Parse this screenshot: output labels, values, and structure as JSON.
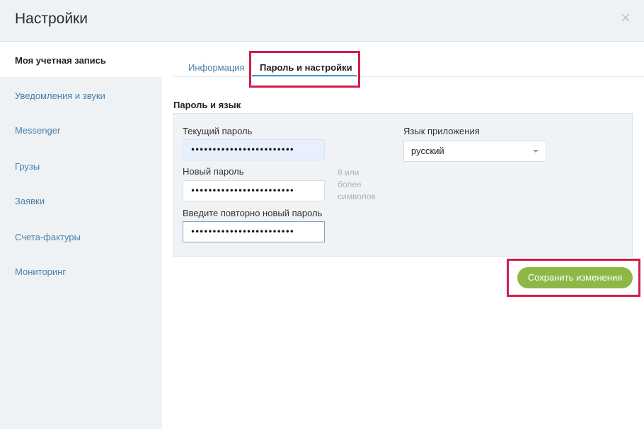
{
  "header": {
    "title": "Настройки",
    "close_glyph": "×"
  },
  "sidebar": {
    "items": [
      {
        "label": "Моя учетная запись",
        "active": true
      },
      {
        "label": "Уведомления и звуки"
      },
      {
        "label": "Messenger"
      },
      {
        "label": "Грузы"
      },
      {
        "label": "Заявки"
      },
      {
        "label": "Счета-фактуры"
      },
      {
        "label": "Мониторинг"
      }
    ]
  },
  "tabs": [
    {
      "label": "Информация",
      "active": false
    },
    {
      "label": "Пароль и настройки",
      "active": true
    }
  ],
  "section": {
    "title": "Пароль и язык"
  },
  "form": {
    "current_password_label": "Текущий пароль",
    "current_password_value": "••••••••••••••••••••••••",
    "new_password_label": "Новый пароль",
    "new_password_value": "••••••••••••••••••••••••",
    "repeat_password_label": "Введите повторно новый пароль",
    "repeat_password_value": "••••••••••••••••••••••••",
    "hint_line1": "8 или",
    "hint_line2": "более",
    "hint_line3": "символов",
    "language_label": "Язык приложения",
    "language_value": "русский"
  },
  "actions": {
    "save_label": "Сохранить изменения"
  },
  "colors": {
    "accent_blue": "#4a9ed6",
    "save_green": "#8db848",
    "highlight_red": "#d11d4a"
  }
}
